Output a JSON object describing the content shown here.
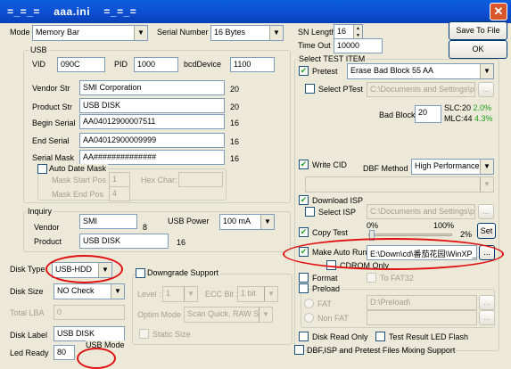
{
  "window": {
    "title": "=_=_=    aaa.ini    =_=_=",
    "close": "✕"
  },
  "mode": {
    "label": "Mode",
    "value": "Memory Bar"
  },
  "serial_number": {
    "label": "Serial Number",
    "value": "16 Bytes"
  },
  "sn_length": {
    "label": "SN Length",
    "value": "16"
  },
  "time_out": {
    "label": "Time Out",
    "value": "10000"
  },
  "buttons": {
    "save_to_file": "Save To File",
    "ok": "OK"
  },
  "usb": {
    "group": "USB",
    "vid_label": "VID",
    "vid": "090C",
    "pid_label": "PID",
    "pid": "1000",
    "bcd_label": "bcdDevice",
    "bcd": "1100",
    "vendor_label": "Vendor Str",
    "vendor": "SMI Corporation",
    "vendor_len": "20",
    "product_label": "Product Str",
    "product": "USB DISK",
    "product_len": "20",
    "begin_label": "Begin Serial",
    "begin": "AA04012900007511",
    "begin_len": "16",
    "end_label": "End Serial",
    "end": "AA04012900009999",
    "end_len": "16",
    "mask_label": "Serial Mask",
    "mask": "AA##############",
    "mask_len": "16",
    "auto_date_mask": "Auto Date Mask",
    "mask_start_label": "Mask Start Pos",
    "mask_start": "1",
    "hex_char_label": "Hex Char:",
    "mask_end_label": "Mask End Pos",
    "mask_end": "4"
  },
  "inquiry": {
    "group": "Inquiry",
    "vendor_label": "Vendor",
    "vendor": "SMI",
    "vendor_len": "8",
    "product_label": "Product",
    "product": "USB DISK",
    "product_len": "16",
    "usb_power_label": "USB Power",
    "usb_power": "100 mA"
  },
  "disk_type": {
    "label": "Disk Type",
    "value": "USB-HDD"
  },
  "disk_size": {
    "label": "Disk Size",
    "value": "NO Check"
  },
  "total_lba": {
    "label": "Total LBA",
    "value": "0"
  },
  "disk_label": {
    "label": "Disk Label",
    "value": "USB DISK"
  },
  "led_ready": {
    "label": "Led Ready",
    "value": "80"
  },
  "usb_mode": {
    "label": "USB Mode"
  },
  "downgrade": {
    "label": "Downgrade Support",
    "level_label": "Level :",
    "level": "1",
    "ecc_label": "ECC Bit :",
    "ecc": "1 bit",
    "optim_label": "Optim Mode :",
    "optim": "Scan Quick, RAW Slo",
    "static_size": "Static Size"
  },
  "test_item": {
    "group": "Select TEST ITEM",
    "pretest": "Pretest",
    "pretest_value": "Erase Bad Block 55 AA",
    "select_ptest": "Select PTest",
    "ptest_path": "C:\\Documents and Settings\\pit",
    "bad_block_label": "Bad Block",
    "bad_block": "20",
    "slc_label": "SLC:20",
    "slc_pct": "2.0%",
    "mlc_label": "MLC:44",
    "mlc_pct": "4.3%",
    "write_cid": "Write CID",
    "dbf_method_label": "DBF Method",
    "dbf_method": "High Performance _",
    "download_isp": "Download ISP",
    "select_isp": "Select ISP",
    "isp_path": "C:\\Documents and Settings\\pit",
    "copy_test": "Copy Test",
    "copy_min": "0%",
    "copy_max": "100%",
    "copy_val": "2%",
    "set": "Set",
    "make_auto_run": "Make Auto Run",
    "auto_run_path": "E:\\Down\\cd\\番茄花园\\WinXP_",
    "browse": "...",
    "cdrom_only": "CDROM Only",
    "format": "Format",
    "to_fat32": "To FAT32",
    "preload": "Preload",
    "fat": "FAT",
    "preload_path": "D:\\Preload\\",
    "non_fat": "Non FAT",
    "disk_read_only": "Disk Read Only",
    "test_result_led": "Test Result LED Flash",
    "dbf_mixing": "DBF,ISP and Pretest Files Mixing Support"
  }
}
